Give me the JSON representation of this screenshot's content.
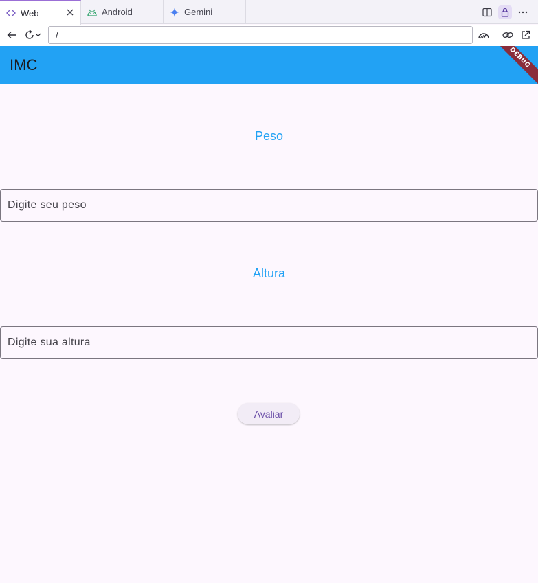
{
  "browser": {
    "tabs": [
      {
        "label": "Web",
        "icon": "code-icon"
      },
      {
        "label": "Android",
        "icon": "android-icon"
      },
      {
        "label": "Gemini",
        "icon": "gemini-sparkle-icon"
      }
    ],
    "url": "/"
  },
  "app": {
    "title": "IMC",
    "debug_banner": "DEBUG",
    "accent_color": "#22a2f4",
    "peso_label": "Peso",
    "peso_placeholder": "Digite seu peso",
    "altura_label": "Altura",
    "altura_placeholder": "Digite sua altura",
    "submit_label": "Avaliar"
  }
}
